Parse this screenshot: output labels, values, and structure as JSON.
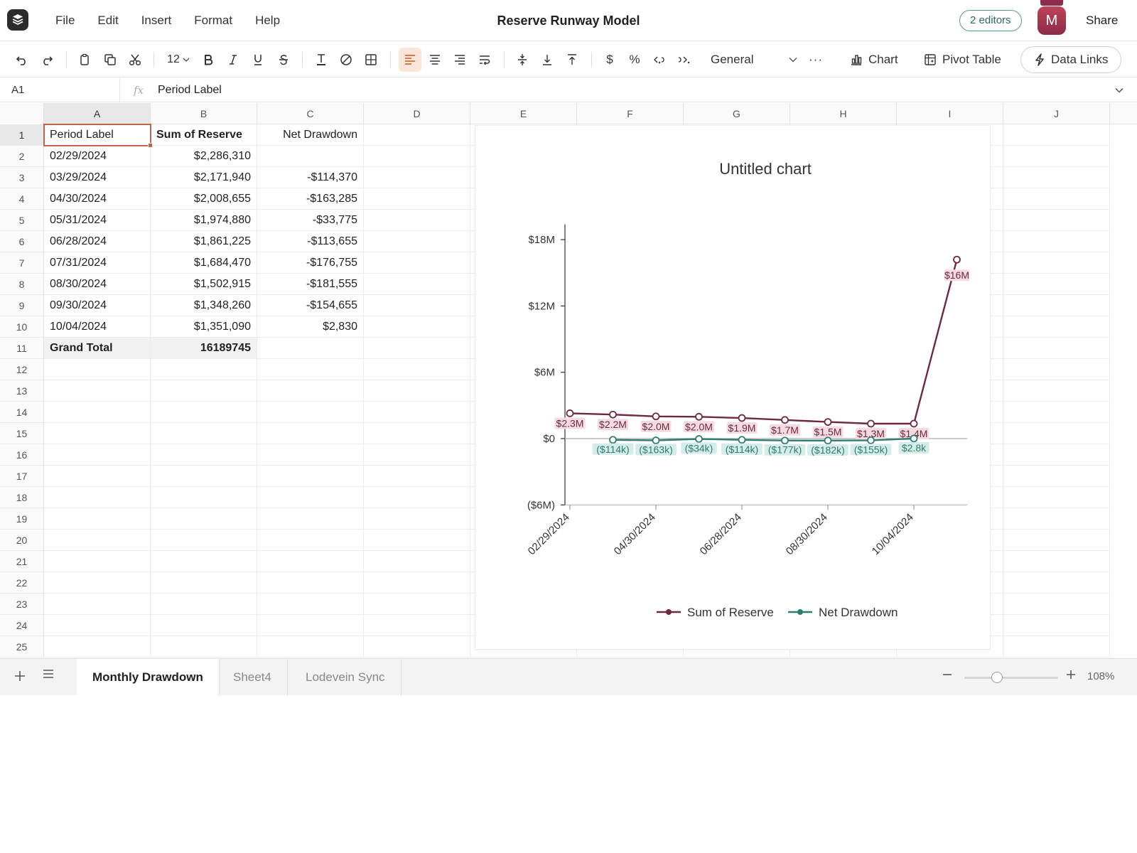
{
  "menubar": {
    "menus": [
      "File",
      "Edit",
      "Insert",
      "Format",
      "Help"
    ],
    "doc_title": "Reserve Runway Model",
    "editors_label": "2 editors",
    "avatar_initial": "M",
    "share_label": "Share"
  },
  "toolbar": {
    "font_size": "12",
    "number_format": "General",
    "more_label": "···",
    "currency_symbol": "$",
    "percent_symbol": "%",
    "chart_label": "Chart",
    "pivot_label": "Pivot Table",
    "data_links_label": "Data Links",
    "accent_color": "#c55a22"
  },
  "formula_bar": {
    "cell_ref": "A1",
    "fx": "fx",
    "value": "Period Label"
  },
  "grid": {
    "columns": [
      "A",
      "B",
      "C",
      "D",
      "E",
      "F",
      "G",
      "H",
      "I",
      "J"
    ],
    "row_numbers": [
      "1",
      "2",
      "3",
      "4",
      "5",
      "6",
      "7",
      "8",
      "9",
      "10",
      "11",
      "12",
      "13",
      "14",
      "15",
      "16",
      "17",
      "18",
      "19",
      "20",
      "21",
      "22",
      "23",
      "24",
      "25"
    ],
    "headers": [
      "Period Label",
      "Sum of Reserve",
      "Net Drawdown"
    ],
    "rows": [
      [
        "02/29/2024",
        "$2,286,310",
        ""
      ],
      [
        "03/29/2024",
        "$2,171,940",
        "-$114,370"
      ],
      [
        "04/30/2024",
        "$2,008,655",
        "-$163,285"
      ],
      [
        "05/31/2024",
        "$1,974,880",
        "-$33,775"
      ],
      [
        "06/28/2024",
        "$1,861,225",
        "-$113,655"
      ],
      [
        "07/31/2024",
        "$1,684,470",
        "-$176,755"
      ],
      [
        "08/30/2024",
        "$1,502,915",
        "-$181,555"
      ],
      [
        "09/30/2024",
        "$1,348,260",
        "-$154,655"
      ],
      [
        "10/04/2024",
        "$1,351,090",
        "$2,830"
      ]
    ],
    "total_row": [
      "Grand Total",
      "16189745",
      ""
    ],
    "selection_color": "#c0654a"
  },
  "chart_data": {
    "type": "line",
    "title": "Untitled chart",
    "xlabel": "",
    "ylabel": "",
    "categories": [
      "02/29/2024",
      "03/29/2024",
      "04/30/2024",
      "05/31/2024",
      "06/28/2024",
      "07/31/2024",
      "08/30/2024",
      "09/30/2024",
      "10/04/2024",
      "Grand Total"
    ],
    "x_tick_labels": [
      "02/29/2024",
      "04/30/2024",
      "06/28/2024",
      "08/30/2024",
      "10/04/2024"
    ],
    "y_ticks": [
      -6000000,
      0,
      6000000,
      12000000,
      18000000
    ],
    "y_tick_labels": [
      "($6M)",
      "$0",
      "$6M",
      "$12M",
      "$18M"
    ],
    "ylim": [
      -6000000,
      21000000
    ],
    "grid": false,
    "legend_position": "bottom",
    "series": [
      {
        "name": "Sum of Reserve",
        "color": "#6e2a3c",
        "label_bg": "#f4dbe2",
        "values": [
          2286310,
          2171940,
          2008655,
          1974880,
          1861225,
          1684470,
          1502915,
          1348260,
          1351090,
          16189745
        ],
        "labels": [
          "$2.3M",
          "$2.2M",
          "$2.0M",
          "$2.0M",
          "$1.9M",
          "$1.7M",
          "$1.5M",
          "$1.3M",
          "$1.4M",
          "$16M"
        ]
      },
      {
        "name": "Net Drawdown",
        "color": "#2e7d72",
        "label_bg": "#d5ede8",
        "values": [
          null,
          -114370,
          -163285,
          -33775,
          -113655,
          -176755,
          -181555,
          -154655,
          2830,
          null
        ],
        "labels": [
          "",
          "($114k)",
          "($163k)",
          "($34k)",
          "($114k)",
          "($177k)",
          "($182k)",
          "($155k)",
          "$2.8k",
          ""
        ]
      }
    ]
  },
  "sheets": {
    "tabs": [
      "Monthly Drawdown",
      "Sheet4",
      "Lodevein Sync"
    ],
    "active_index": 0,
    "zoom_label": "108%",
    "zoom_fraction": 0.35
  }
}
